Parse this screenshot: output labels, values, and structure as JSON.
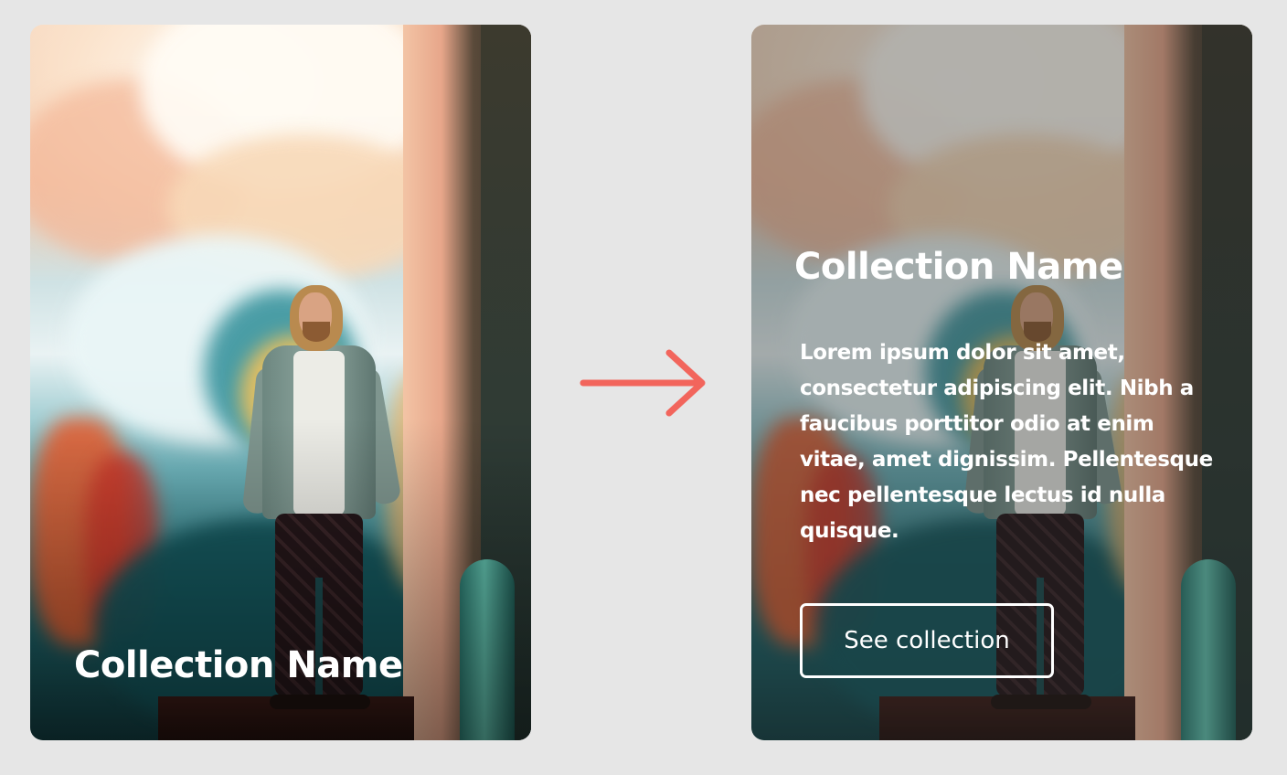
{
  "before_card": {
    "title": "Collection Name"
  },
  "after_card": {
    "title": "Collection Name",
    "description": "Lorem ipsum dolor sit amet, consectetur adipiscing elit. Nibh a faucibus porttitor odio at enim vitae, amet dignissim. Pellentesque nec pellentesque lectus id nulla quisque.",
    "button_label": "See collection"
  },
  "icons": {
    "transition_arrow": "arrow-right-icon"
  },
  "colors": {
    "background": "#e6e6e6",
    "arrow": "#f2655c",
    "text": "#ffffff"
  }
}
